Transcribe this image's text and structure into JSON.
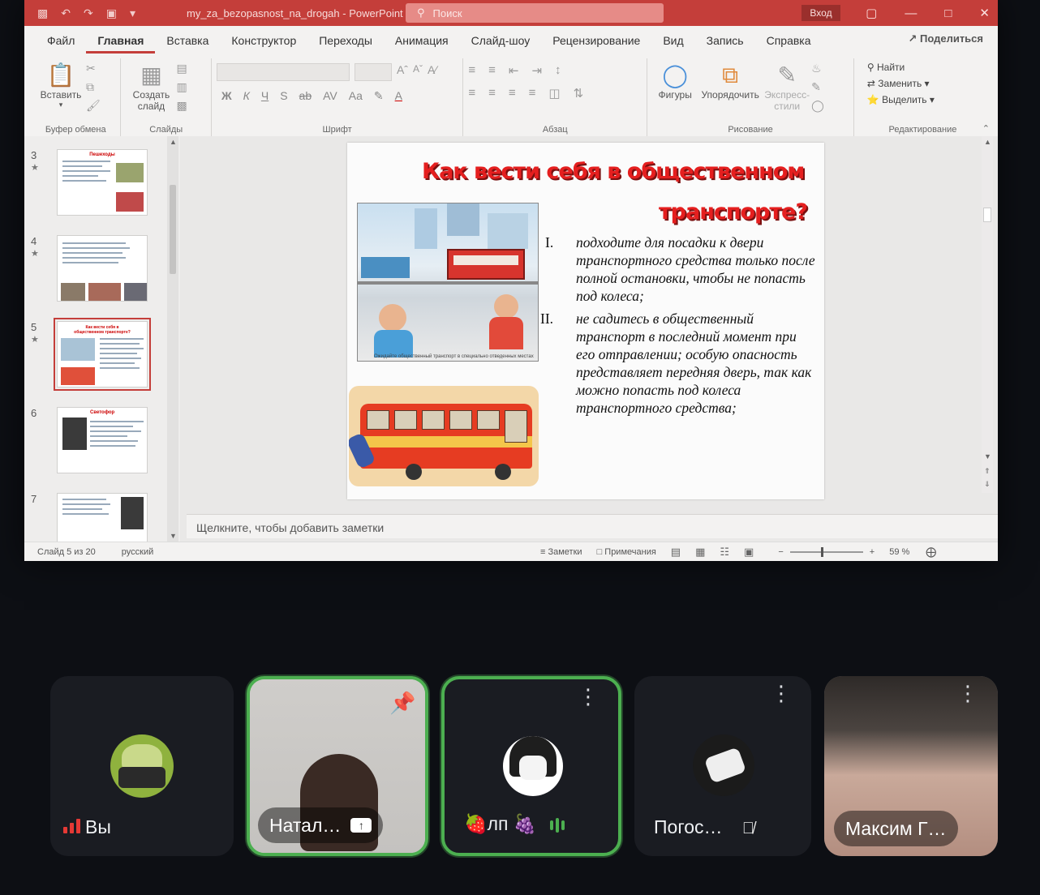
{
  "window": {
    "doc_title": "my_za_bezopasnost_na_drogah  -  PowerPoint",
    "search_placeholder": "Поиск",
    "signin": "Вход",
    "share": "Поделиться"
  },
  "menu": {
    "tabs": [
      "Файл",
      "Главная",
      "Вставка",
      "Конструктор",
      "Переходы",
      "Анимация",
      "Слайд-шоу",
      "Рецензирование",
      "Вид",
      "Запись",
      "Справка"
    ],
    "active_tab": "Главная"
  },
  "ribbon": {
    "paste": "Вставить",
    "new_slide_1": "Создать",
    "new_slide_2": "слайд",
    "clipboard_group": "Буфер обмена",
    "slides_group": "Слайды",
    "font_group": "Шрифт",
    "paragraph_group": "Абзац",
    "shapes": "Фигуры",
    "arrange": "Упорядочить",
    "express_1": "Экспресс-",
    "express_2": "стили",
    "drawing_group": "Рисование",
    "find": "Найти",
    "replace": "Заменить",
    "select": "Выделить",
    "editing_group": "Редактирование",
    "format_buttons": [
      "Ж",
      "К",
      "Ч",
      "S",
      "ab",
      "AV",
      "Aa"
    ]
  },
  "thumbnails": [
    {
      "num": "3",
      "title": "Пешеходы"
    },
    {
      "num": "4",
      "title": ""
    },
    {
      "num": "5",
      "title": "Как вести себя в общественном транспорте?"
    },
    {
      "num": "6",
      "title": "Светофор"
    },
    {
      "num": "7",
      "title": ""
    }
  ],
  "slide": {
    "title_line1": "Как вести себя в общественном",
    "title_line2": "транспорте?",
    "picture_caption": "Ожидайте общественный транспорт в специально отведенных местах",
    "items": [
      {
        "num": "I.",
        "text": "подходите для посадки к двери транспортного средства только после полной остановки, чтобы не попасть под колеса;"
      },
      {
        "num": "II.",
        "text": "не садитесь в общественный транспорт в последний момент при его отправлении; особую опасность представляет передняя дверь, так как можно попасть под колеса транспортного средства;"
      }
    ]
  },
  "notes_placeholder": "Щелкните, чтобы добавить заметки",
  "status": {
    "slide_counter": "Слайд 5 из 20",
    "language": "русский",
    "notes": "Заметки",
    "comments": "Примечания",
    "zoom": "59 %",
    "zoom_level": 59
  },
  "participants": [
    {
      "name": "Вы"
    },
    {
      "name": "Натал…"
    },
    {
      "name": "🍓лп 🍇"
    },
    {
      "name": "Погос…"
    },
    {
      "name": "Максим Г…"
    }
  ],
  "colors": {
    "accent": "#c43e3a",
    "speaking": "#4caf50",
    "title_red": "#e51f1f"
  }
}
